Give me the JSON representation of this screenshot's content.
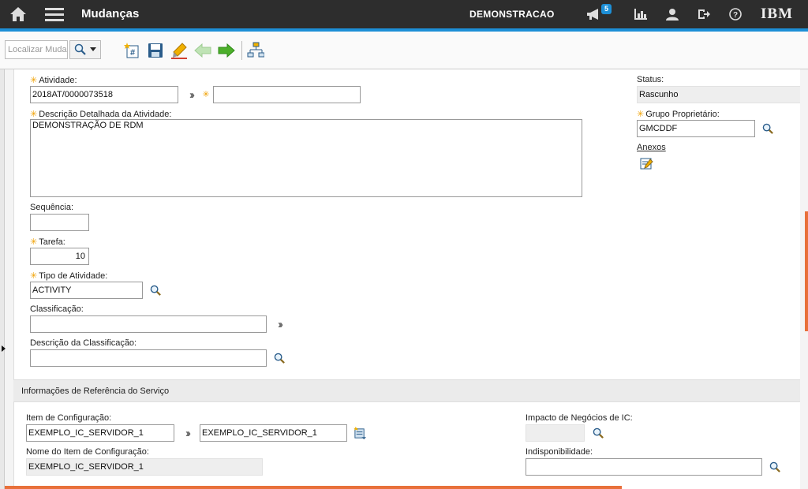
{
  "header": {
    "app_title": "Mudanças",
    "user": "DEMONSTRACAO",
    "notification_count": "5",
    "logo": "IBM",
    "icons": [
      "home-icon",
      "menu-icon",
      "megaphone-icon",
      "reports-icon",
      "profile-icon",
      "logout-icon",
      "help-icon"
    ]
  },
  "toolbar": {
    "search_placeholder": "Localizar Muda",
    "buttons": [
      "new-record-icon",
      "save-icon",
      "clear-changes-icon",
      "previous-record-icon",
      "next-record-icon",
      "view-workflow-icon"
    ]
  },
  "form": {
    "atividade": {
      "label": "Atividade:",
      "value": "2018AT/0000073518",
      "desc_value": ""
    },
    "descricao": {
      "label": "Descrição Detalhada da Atividade:",
      "value": "DEMONSTRAÇÃO DE RDM"
    },
    "sequencia": {
      "label": "Sequência:",
      "value": ""
    },
    "tarefa": {
      "label": "Tarefa:",
      "value": "10"
    },
    "tipo_atividade": {
      "label": "Tipo de Atividade:",
      "value": "ACTIVITY"
    },
    "classificacao": {
      "label": "Classificação:",
      "value": ""
    },
    "descricao_classificacao": {
      "label": "Descrição da Classificação:",
      "value": ""
    },
    "status": {
      "label": "Status:",
      "value": "Rascunho"
    },
    "grupo_proprietario": {
      "label": "Grupo Proprietário:",
      "value": "GMCDDF"
    },
    "anexos": {
      "label": "Anexos"
    }
  },
  "service_ref": {
    "section_title": "Informações de Referência do Serviço",
    "item_configuracao": {
      "label": "Item de Configuração:",
      "value": "EXEMPLO_IC_SERVIDOR_1",
      "value2": "EXEMPLO_IC_SERVIDOR_1"
    },
    "nome_item": {
      "label": "Nome do Item de Configuração:",
      "value": "EXEMPLO_IC_SERVIDOR_1"
    },
    "impacto": {
      "label": "Impacto de Negócios de IC:",
      "value": ""
    },
    "indisponibilidade": {
      "label": "Indisponibilidade:",
      "value": ""
    }
  },
  "colors": {
    "accent": "#1d8fd6",
    "header_bg": "#2d2d2d",
    "required": "#f0a000",
    "scroll": "#e8703a"
  }
}
